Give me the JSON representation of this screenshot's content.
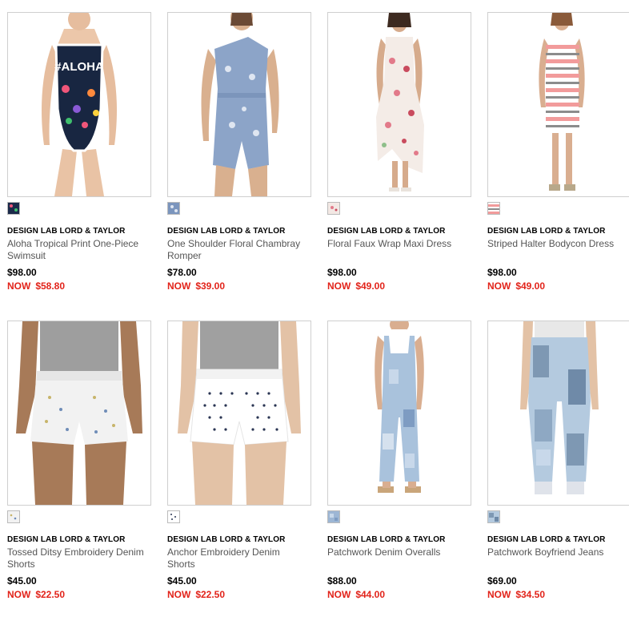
{
  "products": [
    {
      "brand": "DESIGN LAB LORD & TAYLOR",
      "name": "Aloha Tropical Print One-Piece Swimsuit",
      "price": "$98.00",
      "sale_label": "NOW",
      "sale_price": "$58.80",
      "image_icon": "swimsuit-image",
      "swatch_color": "#1b2a4a"
    },
    {
      "brand": "DESIGN LAB LORD & TAYLOR",
      "name": "One Shoulder Floral Chambray Romper",
      "price": "$78.00",
      "sale_label": "NOW",
      "sale_price": "$39.00",
      "image_icon": "romper-image",
      "swatch_color": "#7b95bd"
    },
    {
      "brand": "DESIGN LAB LORD & TAYLOR",
      "name": "Floral Faux Wrap Maxi Dress",
      "price": "$98.00",
      "sale_label": "NOW",
      "sale_price": "$49.00",
      "image_icon": "maxi-dress-image",
      "swatch_color": "#f3e8e4"
    },
    {
      "brand": "DESIGN LAB LORD & TAYLOR",
      "name": "Striped Halter Bodycon Dress",
      "price": "$98.00",
      "sale_label": "NOW",
      "sale_price": "$49.00",
      "image_icon": "bodycon-dress-image",
      "swatch_color": "#f29b9b"
    },
    {
      "brand": "DESIGN LAB LORD & TAYLOR",
      "name": "Tossed Ditsy Embroidery Denim Shorts",
      "price": "$45.00",
      "sale_label": "NOW",
      "sale_price": "$22.50",
      "image_icon": "denim-shorts-image",
      "swatch_color": "#f2f2f2"
    },
    {
      "brand": "DESIGN LAB LORD & TAYLOR",
      "name": "Anchor Embroidery Denim Shorts",
      "price": "$45.00",
      "sale_label": "NOW",
      "sale_price": "$22.50",
      "image_icon": "anchor-shorts-image",
      "swatch_color": "#ffffff"
    },
    {
      "brand": "DESIGN LAB LORD & TAYLOR",
      "name": "Patchwork Denim Overalls",
      "price": "$88.00",
      "sale_label": "NOW",
      "sale_price": "$44.00",
      "image_icon": "overalls-image",
      "swatch_color": "#9db6d4"
    },
    {
      "brand": "DESIGN LAB LORD & TAYLOR",
      "name": "Patchwork Boyfriend Jeans",
      "price": "$69.00",
      "sale_label": "NOW",
      "sale_price": "$34.50",
      "image_icon": "jeans-image",
      "swatch_color": "#7e98b3"
    }
  ],
  "colors": {
    "sale": "#e2231a",
    "brand_text": "#000000",
    "name_text": "#555555",
    "image_border": "#cfcfcf"
  }
}
